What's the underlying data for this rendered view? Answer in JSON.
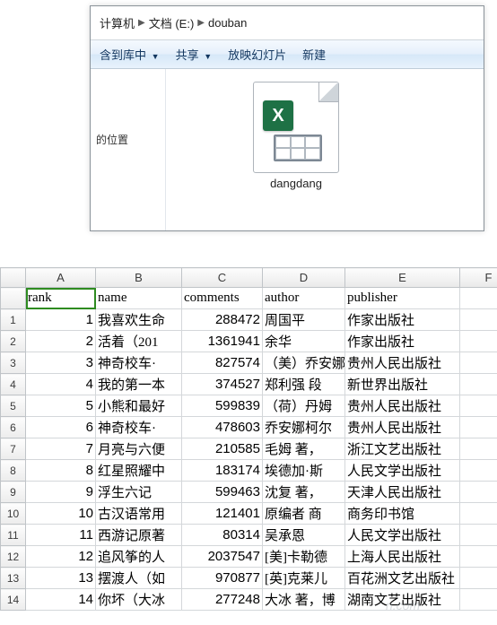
{
  "explorer": {
    "breadcrumbs": [
      "计算机",
      "文档 (E:)",
      "douban"
    ],
    "toolbar": {
      "includeInLib": "含到库中",
      "share": "共享",
      "slideshow": "放映幻灯片",
      "newItem": "新建"
    },
    "sidebar": {
      "locationText": "的位置"
    },
    "file": {
      "name": "dangdang",
      "badge": "X"
    }
  },
  "sheet": {
    "columns": [
      "A",
      "B",
      "C",
      "D",
      "E",
      "F"
    ],
    "rowNumbers": [
      "",
      "1",
      "2",
      "3",
      "4",
      "5",
      "6",
      "7",
      "8",
      "9",
      "10",
      "11",
      "12",
      "13",
      "14"
    ],
    "headerRow": {
      "A": "rank",
      "B": "name",
      "C": "comments",
      "D": "author",
      "E": "publisher",
      "F": ""
    },
    "chart_data": {
      "type": "table",
      "columns": [
        "rank",
        "name",
        "comments",
        "author",
        "publisher"
      ],
      "rows": [
        {
          "rank": 1,
          "name": "我喜欢生命",
          "comments": 288472,
          "author": "周国平",
          "publisher": "作家出版社"
        },
        {
          "rank": 2,
          "name": "活着（201",
          "comments": 1361941,
          "author": "余华",
          "publisher": "作家出版社"
        },
        {
          "rank": 3,
          "name": "神奇校车·",
          "comments": 827574,
          "author": "（美）乔安娜",
          "publisher": "贵州人民出版社"
        },
        {
          "rank": 4,
          "name": "我的第一本",
          "comments": 374527,
          "author": "郑利强 段",
          "publisher": "新世界出版社"
        },
        {
          "rank": 5,
          "name": "小熊和最好",
          "comments": 599839,
          "author": "（荷）丹姆",
          "publisher": "贵州人民出版社"
        },
        {
          "rank": 6,
          "name": "神奇校车·",
          "comments": 478603,
          "author": "乔安娜柯尔",
          "publisher": "贵州人民出版社"
        },
        {
          "rank": 7,
          "name": "月亮与六便",
          "comments": 210585,
          "author": "毛姆 著，",
          "publisher": "浙江文艺出版社"
        },
        {
          "rank": 8,
          "name": "红星照耀中",
          "comments": 183174,
          "author": "埃德加·斯",
          "publisher": "人民文学出版社"
        },
        {
          "rank": 9,
          "name": "浮生六记",
          "comments": 599463,
          "author": "沈复 著，",
          "publisher": "天津人民出版社"
        },
        {
          "rank": 10,
          "name": "古汉语常用",
          "comments": 121401,
          "author": "原编者 商",
          "publisher": "商务印书馆"
        },
        {
          "rank": 11,
          "name": "西游记原著",
          "comments": 80314,
          "author": "吴承恩",
          "publisher": "人民文学出版社"
        },
        {
          "rank": 12,
          "name": "追风筝的人",
          "comments": 2037547,
          "author": "[美]卡勒德",
          "publisher": "上海人民出版社"
        },
        {
          "rank": 13,
          "name": "摆渡人（如",
          "comments": 970877,
          "author": "[英]克莱儿",
          "publisher": "百花洲文艺出版社"
        },
        {
          "rank": 14,
          "name": "你坏（大冰",
          "comments": 277248,
          "author": "大冰 著，博",
          "publisher": "湖南文艺出版社"
        }
      ]
    }
  },
  "watermark": "n.com"
}
